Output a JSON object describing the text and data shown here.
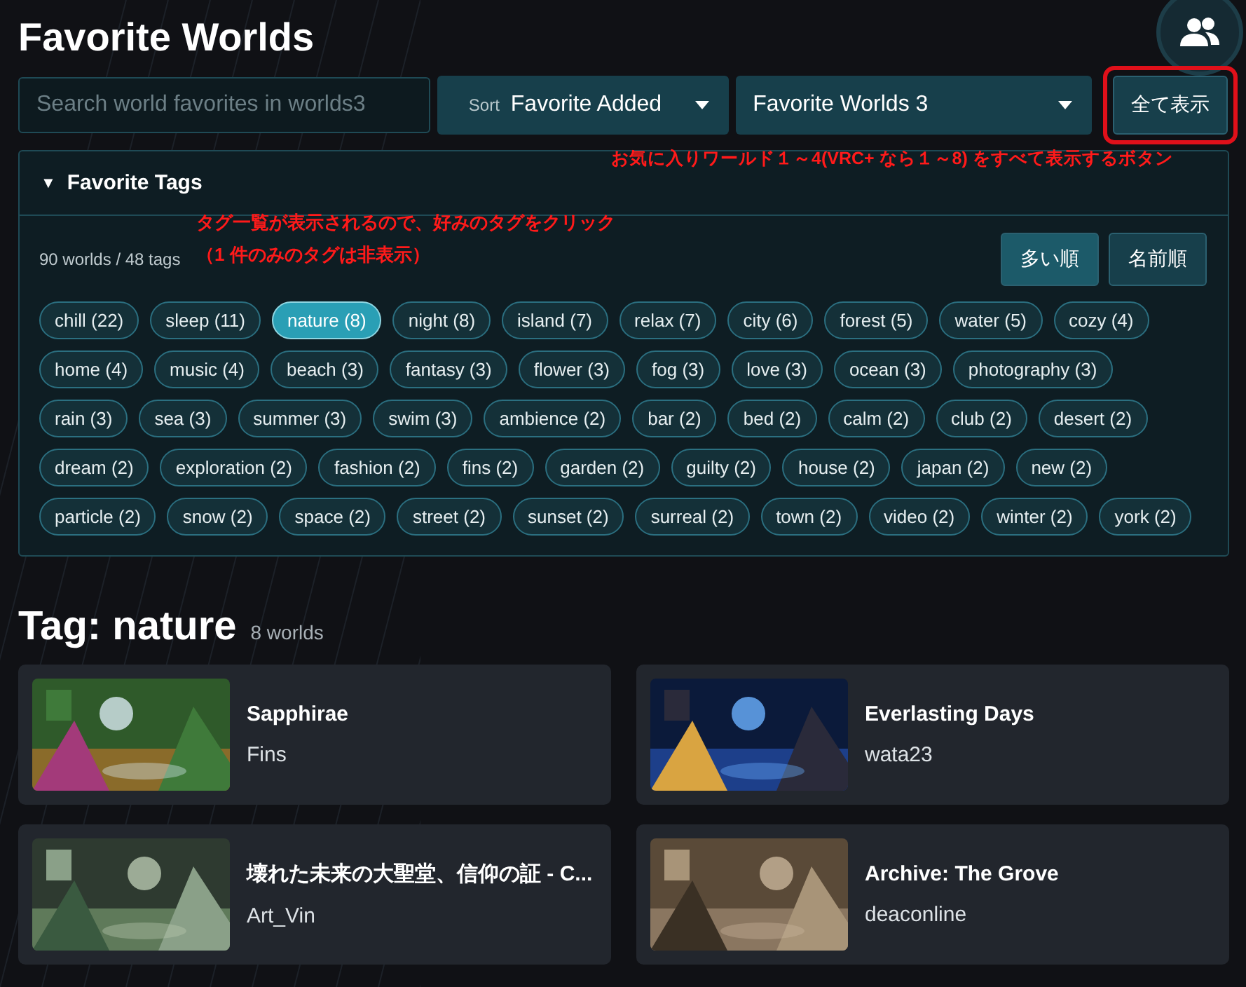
{
  "header": {
    "title": "Favorite Worlds"
  },
  "toolbar": {
    "search": {
      "placeholder": "Search world favorites in worlds3"
    },
    "sort": {
      "label": "Sort",
      "value": "Favorite Added"
    },
    "group": {
      "value": "Favorite Worlds 3"
    },
    "show_all_button": "全て表示"
  },
  "annotations": [
    {
      "text": "お気に入りワールド１～4(VRC+ なら１～8) をすべて表示するボタン"
    },
    {
      "text": "タグ一覧が表示されるので、好みのタグをクリック"
    },
    {
      "text": "（1 件のみのタグは非表示）"
    }
  ],
  "tags_panel": {
    "caret": "▼",
    "title": "Favorite Tags",
    "expanded": true,
    "summary": "90 worlds / 48 tags",
    "sort_buttons": [
      {
        "label": "多い順",
        "selected": true
      },
      {
        "label": "名前順",
        "selected": false
      }
    ],
    "tags": [
      {
        "label": "chill (22)",
        "selected": false
      },
      {
        "label": "sleep (11)",
        "selected": false
      },
      {
        "label": "nature (8)",
        "selected": true
      },
      {
        "label": "night (8)",
        "selected": false
      },
      {
        "label": "island (7)",
        "selected": false
      },
      {
        "label": "relax (7)",
        "selected": false
      },
      {
        "label": "city (6)",
        "selected": false
      },
      {
        "label": "forest (5)",
        "selected": false
      },
      {
        "label": "water (5)",
        "selected": false
      },
      {
        "label": "cozy (4)",
        "selected": false
      },
      {
        "label": "home (4)",
        "selected": false
      },
      {
        "label": "music (4)",
        "selected": false
      },
      {
        "label": "beach (3)",
        "selected": false
      },
      {
        "label": "fantasy (3)",
        "selected": false
      },
      {
        "label": "flower (3)",
        "selected": false
      },
      {
        "label": "fog (3)",
        "selected": false
      },
      {
        "label": "love (3)",
        "selected": false
      },
      {
        "label": "ocean (3)",
        "selected": false
      },
      {
        "label": "photography (3)",
        "selected": false
      },
      {
        "label": "rain (3)",
        "selected": false
      },
      {
        "label": "sea (3)",
        "selected": false
      },
      {
        "label": "summer (3)",
        "selected": false
      },
      {
        "label": "swim (3)",
        "selected": false
      },
      {
        "label": "ambience (2)",
        "selected": false
      },
      {
        "label": "bar (2)",
        "selected": false
      },
      {
        "label": "bed (2)",
        "selected": false
      },
      {
        "label": "calm (2)",
        "selected": false
      },
      {
        "label": "club (2)",
        "selected": false
      },
      {
        "label": "desert (2)",
        "selected": false
      },
      {
        "label": "dream (2)",
        "selected": false
      },
      {
        "label": "exploration (2)",
        "selected": false
      },
      {
        "label": "fashion (2)",
        "selected": false
      },
      {
        "label": "fins (2)",
        "selected": false
      },
      {
        "label": "garden (2)",
        "selected": false
      },
      {
        "label": "guilty (2)",
        "selected": false
      },
      {
        "label": "house (2)",
        "selected": false
      },
      {
        "label": "japan (2)",
        "selected": false
      },
      {
        "label": "new (2)",
        "selected": false
      },
      {
        "label": "particle (2)",
        "selected": false
      },
      {
        "label": "snow (2)",
        "selected": false
      },
      {
        "label": "space (2)",
        "selected": false
      },
      {
        "label": "street (2)",
        "selected": false
      },
      {
        "label": "sunset (2)",
        "selected": false
      },
      {
        "label": "surreal (2)",
        "selected": false
      },
      {
        "label": "town (2)",
        "selected": false
      },
      {
        "label": "video (2)",
        "selected": false
      },
      {
        "label": "winter (2)",
        "selected": false
      },
      {
        "label": "york (2)",
        "selected": false
      }
    ]
  },
  "results": {
    "title": "Tag: nature",
    "count": "8 worlds",
    "worlds": [
      {
        "name": "Sapphirae",
        "author": "Fins"
      },
      {
        "name": "Everlasting Days",
        "author": "wata23"
      },
      {
        "name": "壊れた未来の大聖堂、信仰の証 - C...",
        "author": "Art_Vin"
      },
      {
        "name": "Archive: The Grove",
        "author": "deaconline"
      }
    ]
  }
}
